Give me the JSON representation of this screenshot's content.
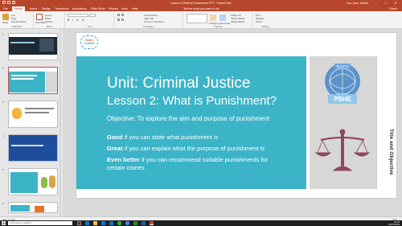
{
  "window": {
    "title": "Lesson 2 What is Punishment PPT - PowerPoint",
    "user": "Cao Juan, Danflh"
  },
  "tabs": [
    "File",
    "Home",
    "Insert",
    "Design",
    "Transitions",
    "Animations",
    "Slide Show",
    "Review",
    "View",
    "Help"
  ],
  "tell_me": "Tell me what you want to do",
  "share": "Share",
  "ribbon": {
    "paste": "Paste",
    "cut": "Cut",
    "copy": "Copy",
    "format_painter": "Format Painter",
    "clipboard": "Clipboard",
    "new_slide": "New Slide",
    "layout": "Layout",
    "reset": "Reset",
    "section": "Section",
    "slides": "Slides",
    "font": "Font",
    "paragraph": "Paragraph",
    "text_direction": "Text Direction",
    "align_text": "Align Text",
    "convert_smartart": "Convert to SmartArt",
    "arrange": "Arrange",
    "quick_styles": "Quick Styles",
    "shape_fill": "Shape Fill",
    "shape_outline": "Shape Outline",
    "shape_effects": "Shape Effects",
    "drawing": "Drawing",
    "find": "Find",
    "replace": "Replace",
    "select": "Select",
    "editing": "Editing"
  },
  "thumbnails": [
    {
      "num": "1"
    },
    {
      "num": "2"
    },
    {
      "num": "3"
    },
    {
      "num": "4"
    },
    {
      "num": "5"
    },
    {
      "num": "6"
    }
  ],
  "slide": {
    "logo_line1": "Evans",
    "logo_line2": "Creative",
    "title": "Unit: Criminal Justice",
    "subtitle": "Lesson 2: What is Punishment?",
    "objective": "Objective: To explore the aim and purpose of punishment",
    "good_label": "Good",
    "good_text": " if you can state what punishment is",
    "great_label": "Great",
    "great_text": " if you can explain what the purpose of punishment is",
    "even_better_label": "Even better",
    "even_better_text": " if you can recommend suitable punishments for",
    "even_better_text2": "certain crimes",
    "badge_text": "PSHE",
    "badge_top": "RIGHTS",
    "side_label": "Title and Objective"
  },
  "status": {
    "slide_count": "Slide 2 of 24",
    "zoom": "64%"
  },
  "taskbar": {
    "search_placeholder": "Type here to search",
    "time": "10:19",
    "date": "01/07/2019"
  },
  "colors": {
    "accent": "#b7472a",
    "teal": "#3cb4c8",
    "scales": "#8b4a5c"
  }
}
